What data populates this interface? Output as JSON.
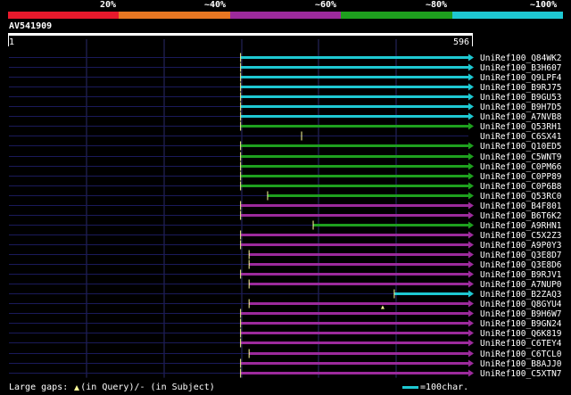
{
  "legend": {
    "labels": [
      "20%",
      "~40%",
      "~60%",
      "~80%",
      "~100%"
    ],
    "colors": [
      "#e8192c",
      "#e87722",
      "#9c2a9c",
      "#1ea01e",
      "#1ec8d2"
    ]
  },
  "query": {
    "id": "AV541909",
    "start": "1",
    "end": "596",
    "length": 596
  },
  "hits": [
    {
      "name": "UniRef100_Q84WK2",
      "start": 301,
      "end": 596,
      "color": "#1ec8d2"
    },
    {
      "name": "UniRef100_B3H607",
      "start": 301,
      "end": 596,
      "color": "#1ec8d2"
    },
    {
      "name": "UniRef100_Q9LPF4",
      "start": 301,
      "end": 596,
      "color": "#1ec8d2"
    },
    {
      "name": "UniRef100_B9RJ75",
      "start": 301,
      "end": 596,
      "color": "#1ec8d2"
    },
    {
      "name": "UniRef100_B9GU53",
      "start": 301,
      "end": 596,
      "color": "#1ec8d2"
    },
    {
      "name": "UniRef100_B9H7D5",
      "start": 301,
      "end": 596,
      "color": "#1ec8d2"
    },
    {
      "name": "UniRef100_A7NVB8",
      "start": 301,
      "end": 596,
      "color": "#1ec8d2"
    },
    {
      "name": "UniRef100_Q53RH1",
      "start": 301,
      "end": 596,
      "color": "#1ea01e"
    },
    {
      "name": "UniRef100_C6SX41",
      "start": 380,
      "end": 380,
      "color": "#1ea01e"
    },
    {
      "name": "UniRef100_Q10ED5",
      "start": 301,
      "end": 596,
      "color": "#1ea01e"
    },
    {
      "name": "UniRef100_C5WNT9",
      "start": 301,
      "end": 596,
      "color": "#1ea01e"
    },
    {
      "name": "UniRef100_C0PM66",
      "start": 301,
      "end": 596,
      "color": "#1ea01e"
    },
    {
      "name": "UniRef100_C0PP89",
      "start": 301,
      "end": 596,
      "color": "#1ea01e"
    },
    {
      "name": "UniRef100_C0P6B8",
      "start": 301,
      "end": 596,
      "color": "#1ea01e"
    },
    {
      "name": "UniRef100_Q53RC0",
      "start": 336,
      "end": 596,
      "color": "#1ea01e"
    },
    {
      "name": "UniRef100_B4F801",
      "start": 301,
      "end": 596,
      "color": "#9c2a9c"
    },
    {
      "name": "UniRef100_B6T6K2",
      "start": 301,
      "end": 596,
      "color": "#9c2a9c"
    },
    {
      "name": "UniRef100_A9RHN1",
      "start": 395,
      "end": 596,
      "color": "#1ea01e"
    },
    {
      "name": "UniRef100_C5X2Z3",
      "start": 301,
      "end": 596,
      "color": "#9c2a9c"
    },
    {
      "name": "UniRef100_A9P0Y3",
      "start": 301,
      "end": 596,
      "color": "#9c2a9c"
    },
    {
      "name": "UniRef100_Q3E8D7",
      "start": 312,
      "end": 596,
      "color": "#9c2a9c"
    },
    {
      "name": "UniRef100_Q3E8D6",
      "start": 312,
      "end": 596,
      "color": "#9c2a9c"
    },
    {
      "name": "UniRef100_B9RJV1",
      "start": 301,
      "end": 596,
      "color": "#9c2a9c"
    },
    {
      "name": "UniRef100_A7NUP0",
      "start": 312,
      "end": 596,
      "color": "#9c2a9c"
    },
    {
      "name": "UniRef100_B2ZAQ3",
      "start": 500,
      "end": 596,
      "color": "#1ec8d2"
    },
    {
      "name": "UniRef100_Q8GYU4",
      "start": 312,
      "end": 596,
      "color": "#9c2a9c"
    },
    {
      "name": "UniRef100_B9H6W7",
      "start": 301,
      "end": 596,
      "color": "#9c2a9c"
    },
    {
      "name": "UniRef100_B9GN24",
      "start": 301,
      "end": 596,
      "color": "#9c2a9c"
    },
    {
      "name": "UniRef100_Q6K819",
      "start": 301,
      "end": 596,
      "color": "#9c2a9c"
    },
    {
      "name": "UniRef100_C6TEY4",
      "start": 301,
      "end": 596,
      "color": "#9c2a9c"
    },
    {
      "name": "UniRef100_C6TCL0",
      "start": 312,
      "end": 596,
      "color": "#9c2a9c"
    },
    {
      "name": "UniRef100_B8AJJ0",
      "start": 301,
      "end": 596,
      "color": "#9c2a9c"
    },
    {
      "name": "UniRef100_C5XTN7",
      "start": 301,
      "end": 596,
      "color": "#9c2a9c"
    }
  ],
  "gap_marks": [
    {
      "row": 25,
      "position": 485
    }
  ],
  "footer": {
    "gaps_prefix": "Large gaps:",
    "gaps_suffix": "(in Query)/- (in Subject)",
    "scale_label": "=100char.",
    "scale_color": "#1ec8d2"
  }
}
